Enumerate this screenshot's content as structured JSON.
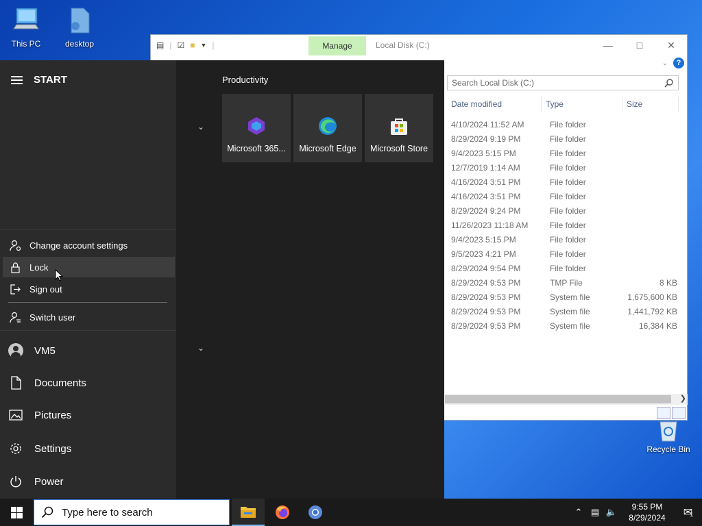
{
  "desktop": {
    "icons": [
      {
        "label": "This PC"
      },
      {
        "label": "desktop"
      },
      {
        "label": "Recycle Bin"
      }
    ]
  },
  "explorer": {
    "manage_tab": "Manage",
    "title": "Local Disk (C:)",
    "search_placeholder": "Search Local Disk (C:)",
    "columns": [
      "Date modified",
      "Type",
      "Size"
    ],
    "rows": [
      {
        "date": "4/10/2024 11:52 AM",
        "type": "File folder",
        "size": ""
      },
      {
        "date": "8/29/2024 9:19 PM",
        "type": "File folder",
        "size": ""
      },
      {
        "date": "9/4/2023 5:15 PM",
        "type": "File folder",
        "size": ""
      },
      {
        "date": "12/7/2019 1:14 AM",
        "type": "File folder",
        "size": ""
      },
      {
        "date": "4/16/2024 3:51 PM",
        "type": "File folder",
        "size": ""
      },
      {
        "date": "4/16/2024 3:51 PM",
        "type": "File folder",
        "size": ""
      },
      {
        "date": "8/29/2024 9:24 PM",
        "type": "File folder",
        "size": ""
      },
      {
        "date": "11/26/2023 11:18 AM",
        "type": "File folder",
        "size": ""
      },
      {
        "date": "9/4/2023 5:15 PM",
        "type": "File folder",
        "size": ""
      },
      {
        "date": "9/5/2023 4:21 PM",
        "type": "File folder",
        "size": ""
      },
      {
        "date": "8/29/2024 9:54 PM",
        "type": "File folder",
        "size": ""
      },
      {
        "date": "8/29/2024 9:53 PM",
        "type": "TMP File",
        "size": "8 KB"
      },
      {
        "date": "8/29/2024 9:53 PM",
        "type": "System file",
        "size": "1,675,600 KB"
      },
      {
        "date": "8/29/2024 9:53 PM",
        "type": "System file",
        "size": "1,441,792 KB"
      },
      {
        "date": "8/29/2024 9:53 PM",
        "type": "System file",
        "size": "16,384 KB"
      }
    ]
  },
  "start": {
    "header": "START",
    "account_menu": {
      "change_settings": "Change account settings",
      "lock": "Lock",
      "sign_out": "Sign out",
      "switch_user": "Switch user"
    },
    "nav": {
      "user": "VM5",
      "documents": "Documents",
      "pictures": "Pictures",
      "settings": "Settings",
      "power": "Power"
    },
    "group_title": "Productivity",
    "tiles": [
      {
        "label": "Microsoft 365..."
      },
      {
        "label": "Microsoft Edge"
      },
      {
        "label": "Microsoft Store"
      }
    ]
  },
  "taskbar": {
    "search_placeholder": "Type here to search",
    "time": "9:55 PM",
    "date": "8/29/2024",
    "notification_count": "1"
  }
}
